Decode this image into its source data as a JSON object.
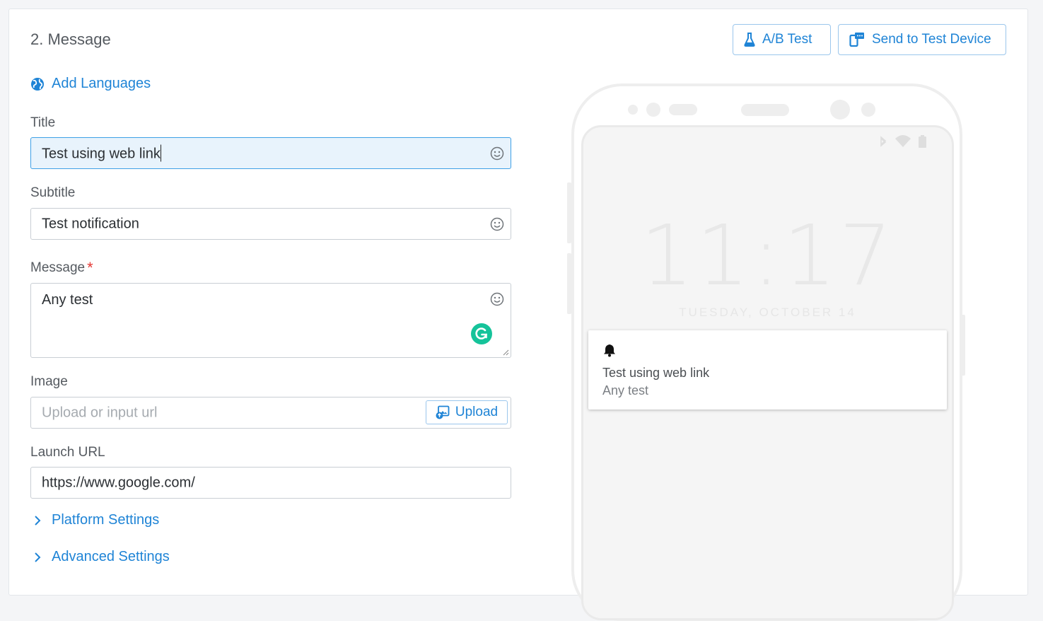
{
  "section": {
    "title": "2. Message"
  },
  "header_buttons": {
    "ab_test": "A/B Test",
    "send_to_test_device": "Send to Test Device"
  },
  "add_languages": "Add Languages",
  "fields": {
    "title": {
      "label": "Title",
      "value": "Test using web link"
    },
    "subtitle": {
      "label": "Subtitle",
      "value": "Test notification"
    },
    "message": {
      "label": "Message",
      "required_mark": "*",
      "value": "Any test"
    },
    "image": {
      "label": "Image",
      "placeholder": "Upload or input url",
      "upload_label": "Upload"
    },
    "launch_url": {
      "label": "Launch URL",
      "value": "https://www.google.com/"
    }
  },
  "expanders": {
    "platform_settings": "Platform Settings",
    "advanced_settings": "Advanced Settings"
  },
  "preview": {
    "time": "11:17",
    "date": "TUESDAY, OCTOBER 14",
    "notification": {
      "title": "Test using web link",
      "body": "Any test"
    }
  },
  "colors": {
    "accent": "#1f84d6",
    "required": "#e53935",
    "grammarly": "#15c39a",
    "focus_bg": "#e8f3fc"
  }
}
